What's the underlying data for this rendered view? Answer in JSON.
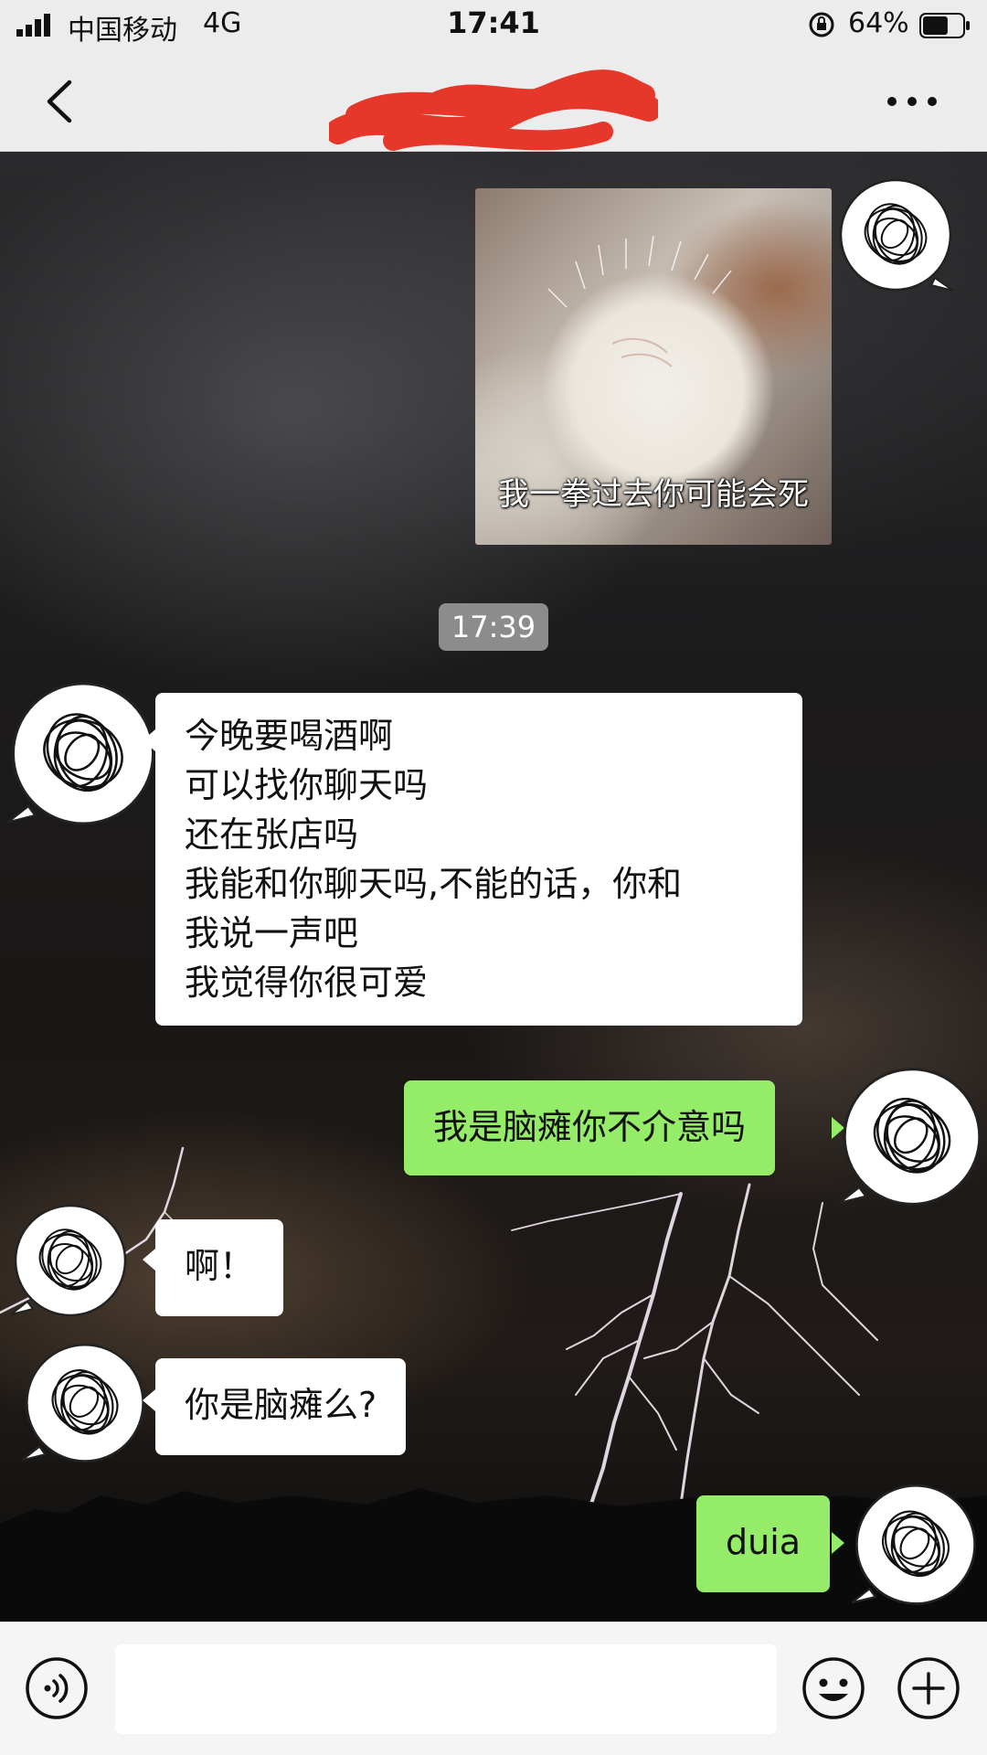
{
  "status_bar": {
    "carrier": "中国移动",
    "network": "4G",
    "time": "17:41",
    "battery": "64%",
    "battery_level": 0.64
  },
  "header": {
    "title": "",
    "title_redacted": true
  },
  "colors": {
    "bubble_outgoing": "#95ec69",
    "bubble_incoming": "#ffffff",
    "timestamp_bg": "#8c8c8c"
  },
  "chat": {
    "sticker_caption": "我一拳过去你可能会死",
    "timestamp": "17:39",
    "messages": [
      {
        "from": "other",
        "lines": [
          "今晚要喝酒啊",
          "可以找你聊天吗",
          "还在张店吗",
          "我能和你聊天吗,不能的话，你和",
          "我说一声吧",
          "我觉得你很可爱"
        ]
      },
      {
        "from": "me",
        "text": "我是脑瘫你不介意吗"
      },
      {
        "from": "other",
        "text": "啊！"
      },
      {
        "from": "other",
        "text": "你是脑瘫么?"
      },
      {
        "from": "me",
        "text": "duia"
      }
    ]
  },
  "input": {
    "placeholder": ""
  },
  "icons": {
    "back": "chevron-left-icon",
    "more": "more-dots-icon",
    "voice": "voice-icon",
    "emoji": "emoji-icon",
    "plus": "plus-icon",
    "avatar": "scribble-avatar"
  }
}
